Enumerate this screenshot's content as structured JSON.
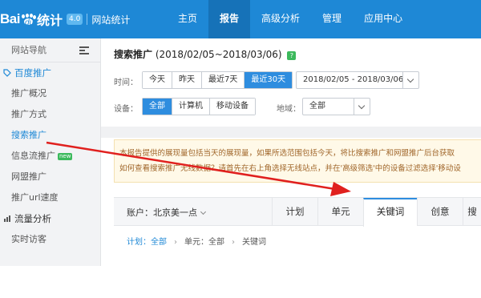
{
  "header": {
    "logo_bai": "Bai",
    "logo_du": "du",
    "logo_text": "统计",
    "version_badge": "4.0",
    "logo_subtitle": "网站统计",
    "nav": [
      {
        "label": "主页",
        "active": false
      },
      {
        "label": "报告",
        "active": true
      },
      {
        "label": "高级分析",
        "active": false
      },
      {
        "label": "管理",
        "active": false
      },
      {
        "label": "应用中心",
        "active": false
      }
    ],
    "bar_color": "#1e88d6"
  },
  "sidebar": {
    "title": "网站导航",
    "items": [
      {
        "label": "百度推广",
        "type": "group",
        "icon": "tag-icon"
      },
      {
        "label": "推广概况",
        "type": "item"
      },
      {
        "label": "推广方式",
        "type": "item"
      },
      {
        "label": "搜索推广",
        "type": "item",
        "selected": true
      },
      {
        "label": "信息流推广",
        "type": "item",
        "badge": "new"
      },
      {
        "label": "网盟推广",
        "type": "item"
      },
      {
        "label": "推广url速度",
        "type": "item"
      },
      {
        "label": "流量分析",
        "type": "group",
        "icon": "traffic-icon"
      },
      {
        "label": "实时访客",
        "type": "item"
      }
    ]
  },
  "main": {
    "title": "搜索推广",
    "date_range": "(2018/02/05~2018/03/06)",
    "help_badge": "?",
    "time_label": "时间：",
    "time_buttons": [
      {
        "label": "今天",
        "on": false
      },
      {
        "label": "昨天",
        "on": false
      },
      {
        "label": "最近7天",
        "on": false
      },
      {
        "label": "最近30天",
        "on": true
      }
    ],
    "date_picker_value": "2018/02/05 - 2018/03/06",
    "device_label": "设备：",
    "device_buttons": [
      {
        "label": "全部",
        "on": true
      },
      {
        "label": "计算机",
        "on": false
      },
      {
        "label": "移动设备",
        "on": false
      }
    ],
    "region_label": "地域：",
    "region_value": "全部",
    "notice_line1": "本报告提供的展现量包括当天的展现量，如果所选范围包括今天，将比搜索推广和网盟推广后台获取",
    "notice_line2": "如何查看搜索推广无线数据？请首先在右上角选择无线站点，并在'高级筛选'中的设备过滤选择'移动设",
    "account_label": "账户：北京美一点",
    "tabs": [
      {
        "label": "计划",
        "active": false
      },
      {
        "label": "单元",
        "active": false
      },
      {
        "label": "关键词",
        "active": true
      },
      {
        "label": "创意",
        "active": false
      },
      {
        "label": "搜",
        "active": false
      }
    ],
    "breadcrumb": {
      "plan": "计划：全部",
      "unit": "单元：全部",
      "keyword": "关键词"
    }
  },
  "colors": {
    "accent": "#2e8ddf",
    "annotation_arrow": "#e0201e",
    "notice_text": "#a0662a"
  }
}
